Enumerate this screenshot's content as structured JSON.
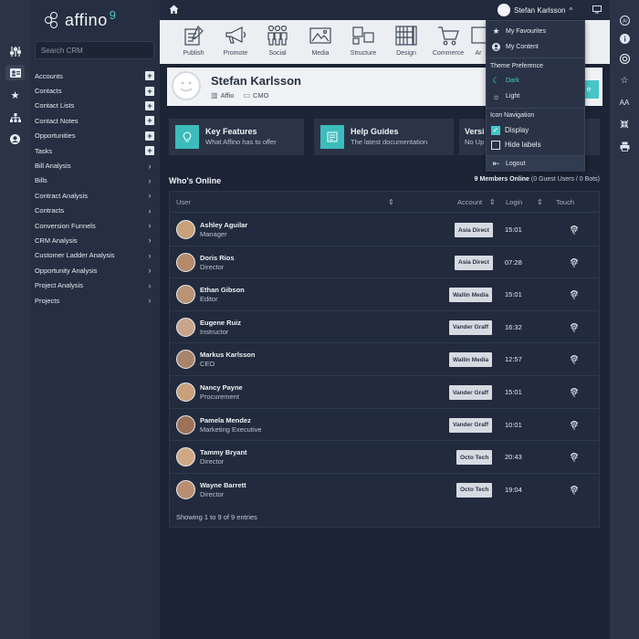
{
  "app": {
    "brand": "affino",
    "brand_sup": "9"
  },
  "search": {
    "placeholder": "Search CRM"
  },
  "sidebar": {
    "items": [
      {
        "label": "Accounts",
        "action": "+"
      },
      {
        "label": "Contacts",
        "action": "+"
      },
      {
        "label": "Contact Lists",
        "action": "+"
      },
      {
        "label": "Contact Notes",
        "action": "+"
      },
      {
        "label": "Opportunities",
        "action": "+"
      },
      {
        "label": "Tasks",
        "action": "+"
      },
      {
        "label": "Bill Analysis",
        "action": "›"
      },
      {
        "label": "Bills",
        "action": "›"
      },
      {
        "label": "Contract Analysis",
        "action": "›"
      },
      {
        "label": "Contracts",
        "action": "›"
      },
      {
        "label": "Conversion Funnels",
        "action": "›"
      },
      {
        "label": "CRM Analysis",
        "action": "›"
      },
      {
        "label": "Customer Ladder Analysis",
        "action": "›"
      },
      {
        "label": "Opportunity Analysis",
        "action": "›"
      },
      {
        "label": "Project Analysis",
        "action": "›"
      },
      {
        "label": "Projects",
        "action": "›"
      }
    ]
  },
  "topbar": {
    "user_name": "Stefan Karlsson",
    "caret": "^"
  },
  "toolbar": {
    "items": [
      "Publish",
      "Promote",
      "Social",
      "Media",
      "Structure",
      "Design",
      "Commerce",
      "Ar"
    ]
  },
  "profile": {
    "name": "Stefan Karlsson",
    "company": "Affio",
    "role": "CMO",
    "action_label": "e"
  },
  "cards": [
    {
      "title": "Key Features",
      "subtitle": "What Affino has to offer",
      "icon": "lightbulb-icon"
    },
    {
      "title": "Help Guides",
      "subtitle": "The latest documentation",
      "icon": "book-icon"
    },
    {
      "title": "Versi",
      "subtitle": "No Up",
      "icon": "version-icon"
    }
  ],
  "online": {
    "title": "Who's Online",
    "members": "9 Members Online",
    "guests": "(0 Guest Users / 0 Bots)"
  },
  "table": {
    "headers": {
      "user": "User",
      "account": "Account",
      "login": "Login",
      "touch": "Touch"
    },
    "rows": [
      {
        "name": "Ashley Aguilar",
        "title": "Manager",
        "account": "Asia Direct",
        "login": "15:01"
      },
      {
        "name": "Doris Rios",
        "title": "Director",
        "account": "Asia Direct",
        "login": "07:28"
      },
      {
        "name": "Ethan Gibson",
        "title": "Editor",
        "account": "Wallin Media",
        "login": "15:01"
      },
      {
        "name": "Eugene Ruiz",
        "title": "Instructor",
        "account": "Vander Graff",
        "login": "16:32"
      },
      {
        "name": "Markus Karlsson",
        "title": "CEO",
        "account": "Wallin Media",
        "login": "12:57"
      },
      {
        "name": "Nancy Payne",
        "title": "Procurement",
        "account": "Vander Graff",
        "login": "15:01"
      },
      {
        "name": "Pamela Mendez",
        "title": "Marketing Executive",
        "account": "Vander Graff",
        "login": "10:01"
      },
      {
        "name": "Tammy Bryant",
        "title": "Director",
        "account": "Octo Tech",
        "login": "20:43"
      },
      {
        "name": "Wayne Barrett",
        "title": "Director",
        "account": "Octo Tech",
        "login": "19:04"
      }
    ],
    "footer": "Showing 1 to 9 of 9 entries"
  },
  "dropdown": {
    "favourites": "My Favourites",
    "content": "My Content",
    "theme_heading": "Theme Preference",
    "dark": "Dark",
    "light": "Light",
    "icon_nav_heading": "Icon Navigation",
    "display": "Display",
    "hide_labels": "Hide labels",
    "logout": "Logout"
  },
  "colors": {
    "accent": "#46c6c8",
    "sidebar_bg": "#262f41",
    "main_bg": "#1c2436"
  }
}
